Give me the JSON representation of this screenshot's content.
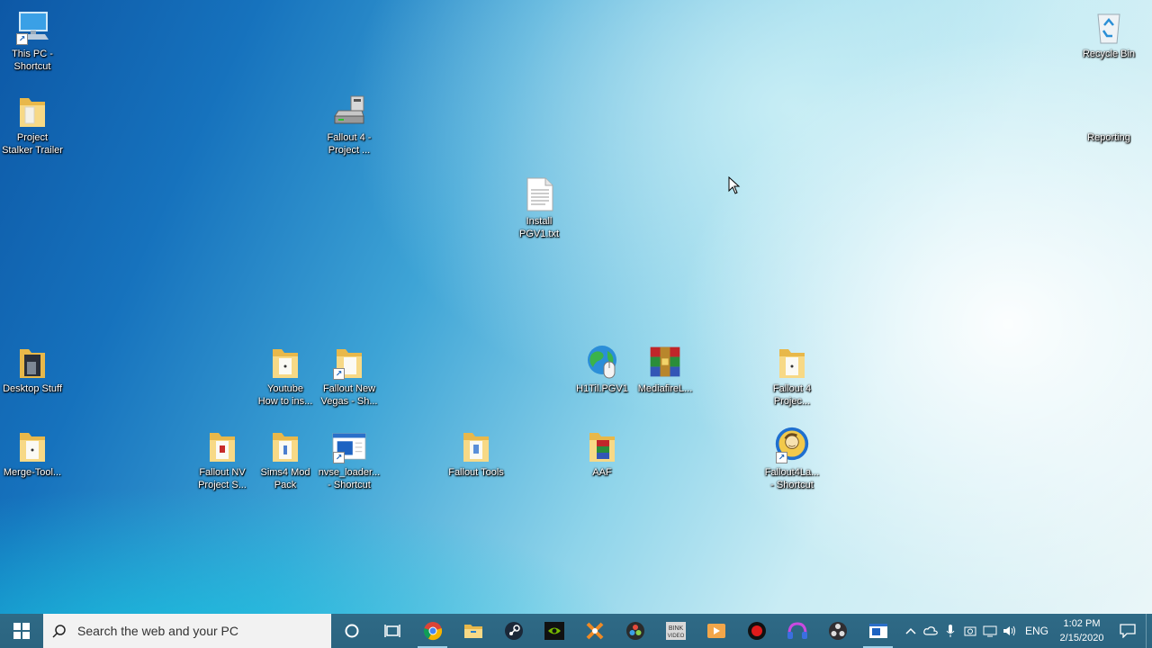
{
  "desktop": {
    "icons": [
      {
        "id": "this-pc",
        "label": "This PC -\nShortcut"
      },
      {
        "id": "project-stalker",
        "label": "Project\nStalker Trailer"
      },
      {
        "id": "fallout4-project-drive",
        "label": "Fallout 4 -\nProject ..."
      },
      {
        "id": "install-pgv1",
        "label": "Install\nPGV1.txt"
      },
      {
        "id": "recycle-bin",
        "label": "Recycle Bin"
      },
      {
        "id": "reporting",
        "label": "Reporting"
      },
      {
        "id": "desktop-stuff",
        "label": "Desktop Stuff"
      },
      {
        "id": "youtube-how-to",
        "label": "Youtube\nHow to ins..."
      },
      {
        "id": "fallout-new-vegas",
        "label": "Fallout New\nVegas - Sh..."
      },
      {
        "id": "h1til-pgv1",
        "label": "H1Til.PGV1"
      },
      {
        "id": "mediafire",
        "label": "MediafireL..."
      },
      {
        "id": "fallout4-projec",
        "label": "Fallout 4\nProjec..."
      },
      {
        "id": "merge-tool",
        "label": "Merge-Tool..."
      },
      {
        "id": "fallout-nv-project",
        "label": "Fallout NV\nProject S..."
      },
      {
        "id": "sims4-mod-pack",
        "label": "Sims4 Mod\nPack"
      },
      {
        "id": "nvse-loader",
        "label": "nvse_loader...\n- Shortcut"
      },
      {
        "id": "fallout-tools",
        "label": "Fallout Tools"
      },
      {
        "id": "aaf",
        "label": "AAF"
      },
      {
        "id": "fallout4launcher",
        "label": "Fallout4La...\n- Shortcut"
      }
    ]
  },
  "taskbar": {
    "search_placeholder": "Search the web and your PC",
    "apps": [
      "cortana-icon",
      "task-view-icon",
      "chrome-icon",
      "file-explorer-icon",
      "steam-icon",
      "nvidia-icon",
      "blender-like-icon",
      "davinci-resolve-icon",
      "bink-video-icon",
      "media-player-icon",
      "record-icon",
      "headset-icon",
      "obs-icon",
      "window-app-icon"
    ],
    "tray": {
      "language": "ENG",
      "time": "1:02 PM",
      "date": "2/15/2020"
    }
  },
  "colors": {
    "taskbar": "#2a657f",
    "folder": "#f4d27a",
    "accent": "#9fd2ea"
  }
}
